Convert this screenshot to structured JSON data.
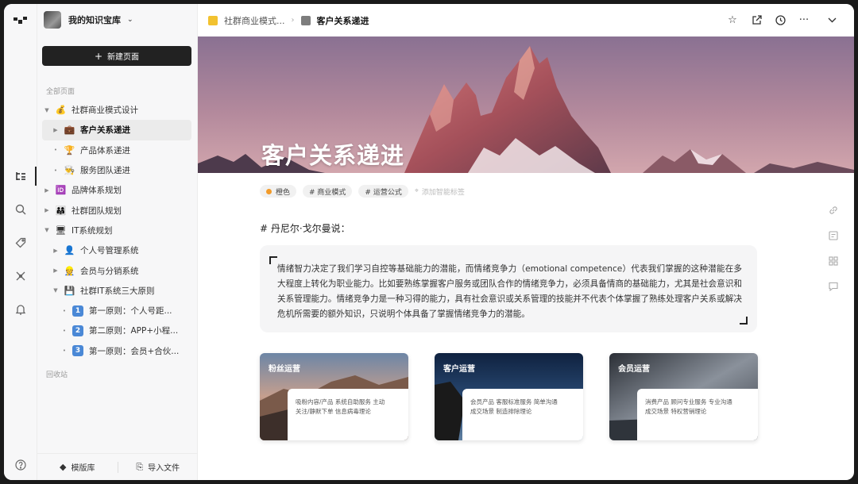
{
  "workspace": {
    "name": "我的知识宝库"
  },
  "sidebar": {
    "new_page_label": "新建页面",
    "section_all": "全部页面",
    "section_trash": "回收站",
    "tree": [
      {
        "label": "社群商业模式设计",
        "icon": "money-bag-icon",
        "emoji": "💰",
        "level": 0,
        "toggle": "▼"
      },
      {
        "label": "客户关系递进",
        "icon": "briefcase-icon",
        "emoji": "💼",
        "level": 1,
        "toggle": "▶",
        "selected": true
      },
      {
        "label": "产品体系递进",
        "icon": "trophy-icon",
        "emoji": "🏆",
        "level": 1,
        "toggle": "•"
      },
      {
        "label": "服务团队递进",
        "icon": "chef-icon",
        "emoji": "👨‍🍳",
        "level": 1,
        "toggle": "•"
      },
      {
        "label": "品牌体系规划",
        "icon": "id-icon",
        "emoji": "🆔",
        "level": 0,
        "toggle": "▶"
      },
      {
        "label": "社群团队规划",
        "icon": "family-icon",
        "emoji": "👨‍👩‍👧",
        "level": 0,
        "toggle": "▶"
      },
      {
        "label": "IT系统规划",
        "icon": "computer-icon",
        "emoji": "🖥",
        "level": 0,
        "toggle": "▼"
      },
      {
        "label": "个人号管理系统",
        "icon": "person-icon",
        "emoji": "👤",
        "level": 1,
        "toggle": "▶"
      },
      {
        "label": "会员与分销系统",
        "icon": "member-icon",
        "emoji": "👷",
        "level": 1,
        "toggle": "▶"
      },
      {
        "label": "社群IT系统三大原则",
        "icon": "floppy-icon",
        "emoji": "💾",
        "level": 1,
        "toggle": "▼"
      },
      {
        "label": "第一原则：个人号距...",
        "icon": "number-1-icon",
        "num": "1",
        "level": 2,
        "toggle": "•"
      },
      {
        "label": "第二原则：APP+小程...",
        "icon": "number-2-icon",
        "num": "2",
        "level": 2,
        "toggle": "•"
      },
      {
        "label": "第一原则：会员+合伙...",
        "icon": "number-3-icon",
        "num": "3",
        "level": 2,
        "toggle": "•"
      }
    ],
    "bottom": {
      "templates": "模版库",
      "import": "导入文件"
    }
  },
  "breadcrumb": {
    "parent": "社群商业模式...",
    "current": "客户关系递进"
  },
  "page": {
    "title": "客户关系递进",
    "tags": [
      "橙色",
      "# 商业模式",
      "# 运营公式"
    ],
    "add_tag": "添加智能标签",
    "heading": "# 丹尼尔·戈尔曼说：",
    "quote": "情绪智力决定了我们学习自控等基础能力的潜能，而情绪竞争力（emotional competence）代表我们掌握的这种潜能在多大程度上转化为职业能力。比如要熟练掌握客户服务或团队合作的情绪竞争力，必须具备情商的基础能力，尤其是社会意识和关系管理能力。情绪竞争力是一种习得的能力，具有社会意识或关系管理的技能并不代表个体掌握了熟练处理客户关系或解决危机所需要的额外知识，只说明个体具备了掌握情绪竞争力的潜能。",
    "cards": [
      {
        "title": "粉丝运营",
        "line1": "吸粉内容/产品  系统自助服务  主动",
        "line2": "关注/静默下单  信息病毒理论"
      },
      {
        "title": "客户运营",
        "line1": "会员产品   客服标准服务   简单沟通",
        "line2": "成交场景  制造排除理论"
      },
      {
        "title": "会员运营",
        "line1": "消费产品   顾问专业服务   专业沟通",
        "line2": "成交场景  特权营销理论"
      }
    ]
  },
  "colors": {
    "accent": "#222222",
    "tag_dot": "#f29b2a",
    "number_badge": "#4a88d6"
  }
}
